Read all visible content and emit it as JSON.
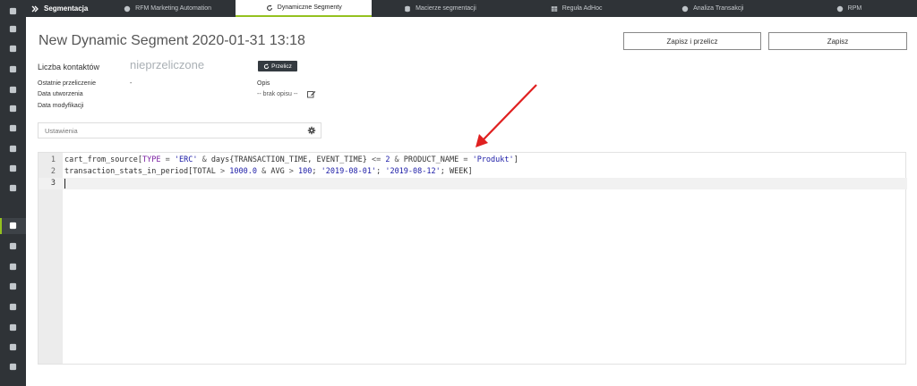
{
  "app": {
    "brand": "Segmentacja"
  },
  "tabs": [
    {
      "label": "RFM Marketing Automation",
      "icon": "globe-icon"
    },
    {
      "label": "Dynamiczne Segmenty",
      "icon": "refresh-icon"
    },
    {
      "label": "Macierze segmentacji",
      "icon": "database-icon"
    },
    {
      "label": "Reguła AdHoc",
      "icon": "table-icon"
    },
    {
      "label": "Analiza Transakcji",
      "icon": "globe-icon"
    },
    {
      "label": "RPM",
      "icon": "globe-icon"
    }
  ],
  "sidebar": {
    "icons": [
      "home-icon",
      "id-card-icon",
      "globe-icon",
      "mobile-icon",
      "user-plus-icon",
      "comment-icon",
      "laptop-icon",
      "bullhorn-icon",
      "users-icon",
      "cogs-icon",
      "grid-icon",
      "area-chart-icon",
      "support-icon",
      "calendar-icon",
      "list-icon",
      "files-icon",
      "wrench-icon",
      "sliders-icon"
    ],
    "active": "grid-icon",
    "active_color": "#94c11f"
  },
  "header": {
    "title": "New Dynamic Segment 2020-01-31 13:18",
    "save_and_recalc": "Zapisz i przelicz",
    "save": "Zapisz"
  },
  "summary": {
    "contacts_label": "Liczba kontaktów",
    "contacts_value": "nieprzeliczone",
    "recalc_label": "Przelicz",
    "last_recalc_label": "Ostatnie przeliczenie",
    "last_recalc_value": "-",
    "created_label": "Data utworzenia",
    "modified_label": "Data modyfikacji",
    "description_label": "Opis",
    "description_value": "-- brak opisu --"
  },
  "settings": {
    "label": "Ustawienia"
  },
  "editor": {
    "lines": [
      {
        "num": "1",
        "tokens": [
          {
            "t": "cart_from_source",
            "c": "p"
          },
          {
            "t": "[",
            "c": "p"
          },
          {
            "t": "TYPE",
            "c": "k"
          },
          {
            "t": " = ",
            "c": "o"
          },
          {
            "t": "'ERC'",
            "c": "s"
          },
          {
            "t": " & ",
            "c": "o"
          },
          {
            "t": "days",
            "c": "p"
          },
          {
            "t": "{TRANSACTION_TIME, EVENT_TIME}",
            "c": "p"
          },
          {
            "t": " <= ",
            "c": "o"
          },
          {
            "t": "2",
            "c": "n"
          },
          {
            "t": " & ",
            "c": "o"
          },
          {
            "t": "PRODUCT_NAME",
            "c": "p"
          },
          {
            "t": " = ",
            "c": "o"
          },
          {
            "t": "'Produkt'",
            "c": "s"
          },
          {
            "t": "]",
            "c": "p"
          }
        ]
      },
      {
        "num": "2",
        "tokens": [
          {
            "t": "transaction_stats_in_period",
            "c": "p"
          },
          {
            "t": "[TOTAL",
            "c": "p"
          },
          {
            "t": " > ",
            "c": "o"
          },
          {
            "t": "1000.0",
            "c": "n"
          },
          {
            "t": " & ",
            "c": "o"
          },
          {
            "t": "AVG",
            "c": "p"
          },
          {
            "t": " > ",
            "c": "o"
          },
          {
            "t": "100",
            "c": "n"
          },
          {
            "t": "; ",
            "c": "p"
          },
          {
            "t": "'2019-08-01'",
            "c": "s"
          },
          {
            "t": "; ",
            "c": "p"
          },
          {
            "t": "'2019-08-12'",
            "c": "s"
          },
          {
            "t": "; WEEK]",
            "c": "p"
          }
        ]
      },
      {
        "num": "3",
        "tokens": []
      }
    ]
  },
  "colors": {
    "accent": "#94c11f",
    "dark": "#2f3337",
    "arrow": "#e02020"
  }
}
